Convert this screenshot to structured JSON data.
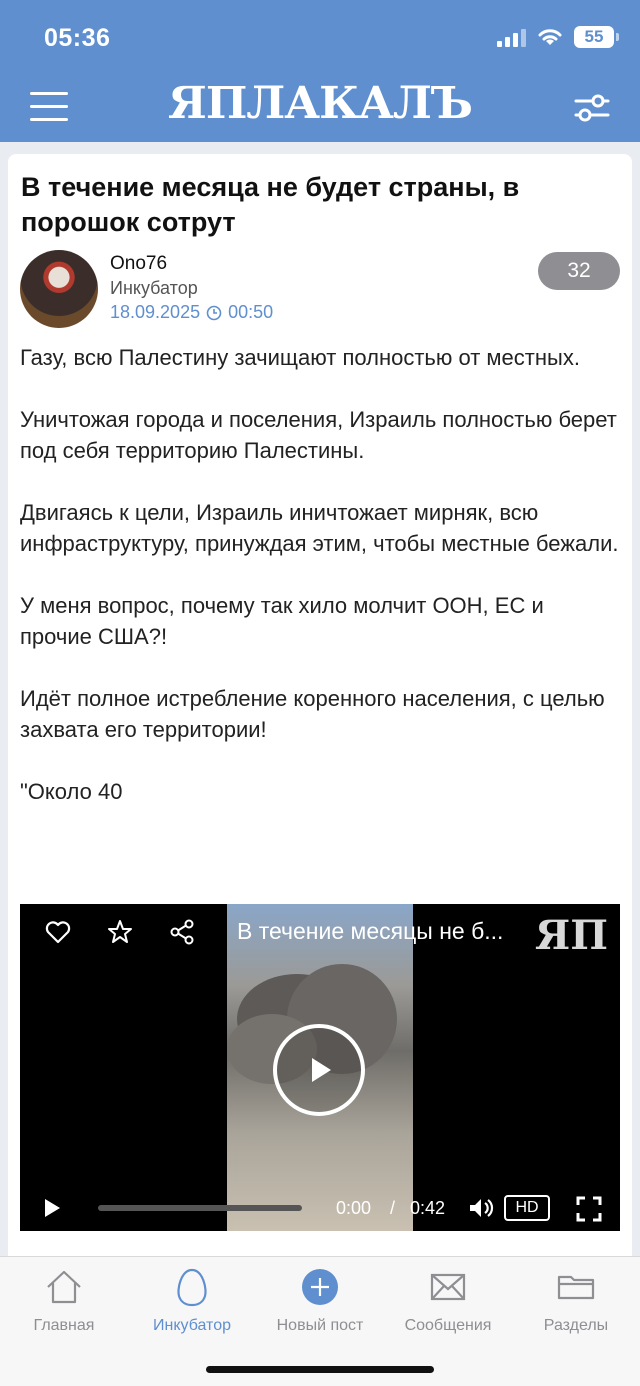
{
  "status_bar": {
    "time": "05:36",
    "battery": "55"
  },
  "header": {
    "logo": "ЯПЛАКАЛЪ"
  },
  "post": {
    "title": "В течение месяца не будет страны, в порошок сотрут",
    "author": "Ono76",
    "rank": "Инкубатор",
    "date": "18.09.2025",
    "time": "00:50",
    "rating": "32",
    "paragraphs": [
      "Газу, всю Палестину зачищают полностью от местных.",
      "Уничтожая города и поселения, Израиль полностью берет под себя территорию Палестины.",
      "Двигаясь к цели, Израиль иничтожает мирняк, всю инфраструктуру, принуждая этим, чтобы местные бежали.",
      "У меня вопрос, почему так хило молчит ООН, ЕС и прочие США?!",
      "Идёт полное истребление коренного населения, с целью захвата его территории!",
      "\"Около 40"
    ]
  },
  "video": {
    "title": "В течение месяцы не б...",
    "logo": "ЯП",
    "current_time": "0:00",
    "separator": "/",
    "duration": "0:42",
    "quality": "HD",
    "progress": 0
  },
  "nav": {
    "items": [
      {
        "label": "Главная",
        "icon": "home-icon"
      },
      {
        "label": "Инкубатор",
        "icon": "egg-icon"
      },
      {
        "label": "Новый пост",
        "icon": "plus-circle-icon"
      },
      {
        "label": "Сообщения",
        "icon": "envelope-icon"
      },
      {
        "label": "Разделы",
        "icon": "folder-icon"
      }
    ],
    "active": "Инкубатор"
  },
  "colors": {
    "brand": "#5f8fcf",
    "rating_bg": "#8e8e93",
    "text": "#222222"
  }
}
